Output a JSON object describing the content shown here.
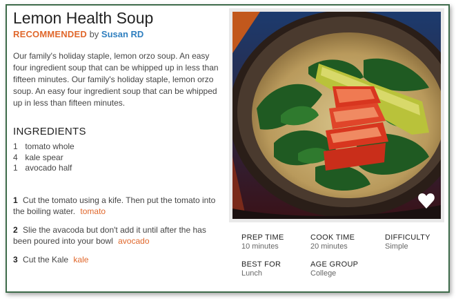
{
  "recipe": {
    "title": "Lemon Health Soup",
    "recommended_label": "RECOMMENDED",
    "by_label": "by",
    "author": "Susan RD",
    "description": "Our family's holiday staple, lemon orzo soup. An easy four ingredient soup that can be whipped up in less than fifteen minutes. Our family's holiday staple, lemon orzo soup. An easy four ingredient soup that can be whipped up in less than fifteen minutes."
  },
  "ingredients": {
    "heading": "INGREDIENTS",
    "items": [
      {
        "qty": "1",
        "name": "tomato whole"
      },
      {
        "qty": "4",
        "name": "kale spear"
      },
      {
        "qty": "1",
        "name": "avocado half"
      }
    ]
  },
  "steps": [
    {
      "num": "1",
      "text": "Cut the tomato using a kife. Then put the tomato into the boiling water.",
      "tag": "tomato"
    },
    {
      "num": "2",
      "text": "Slie the avacoda but don't add it until after the has been poured into your bowl",
      "tag": "avocado"
    },
    {
      "num": "3",
      "text": "Cut the Kale",
      "tag": "kale"
    }
  ],
  "meta": {
    "prep_time_label": "PREP TIME",
    "prep_time_value": "10 minutes",
    "cook_time_label": "COOK TIME",
    "cook_time_value": "20 minutes",
    "difficulty_label": "DIFFICULTY",
    "difficulty_value": "Simple",
    "best_for_label": "BEST FOR",
    "best_for_value": "Lunch",
    "age_group_label": "AGE GROUP",
    "age_group_value": "College"
  },
  "colors": {
    "accent": "#e0672b",
    "author_link": "#2f7fbf",
    "card_border": "#3d6b4a"
  },
  "icons": {
    "favorite": "heart-icon"
  }
}
